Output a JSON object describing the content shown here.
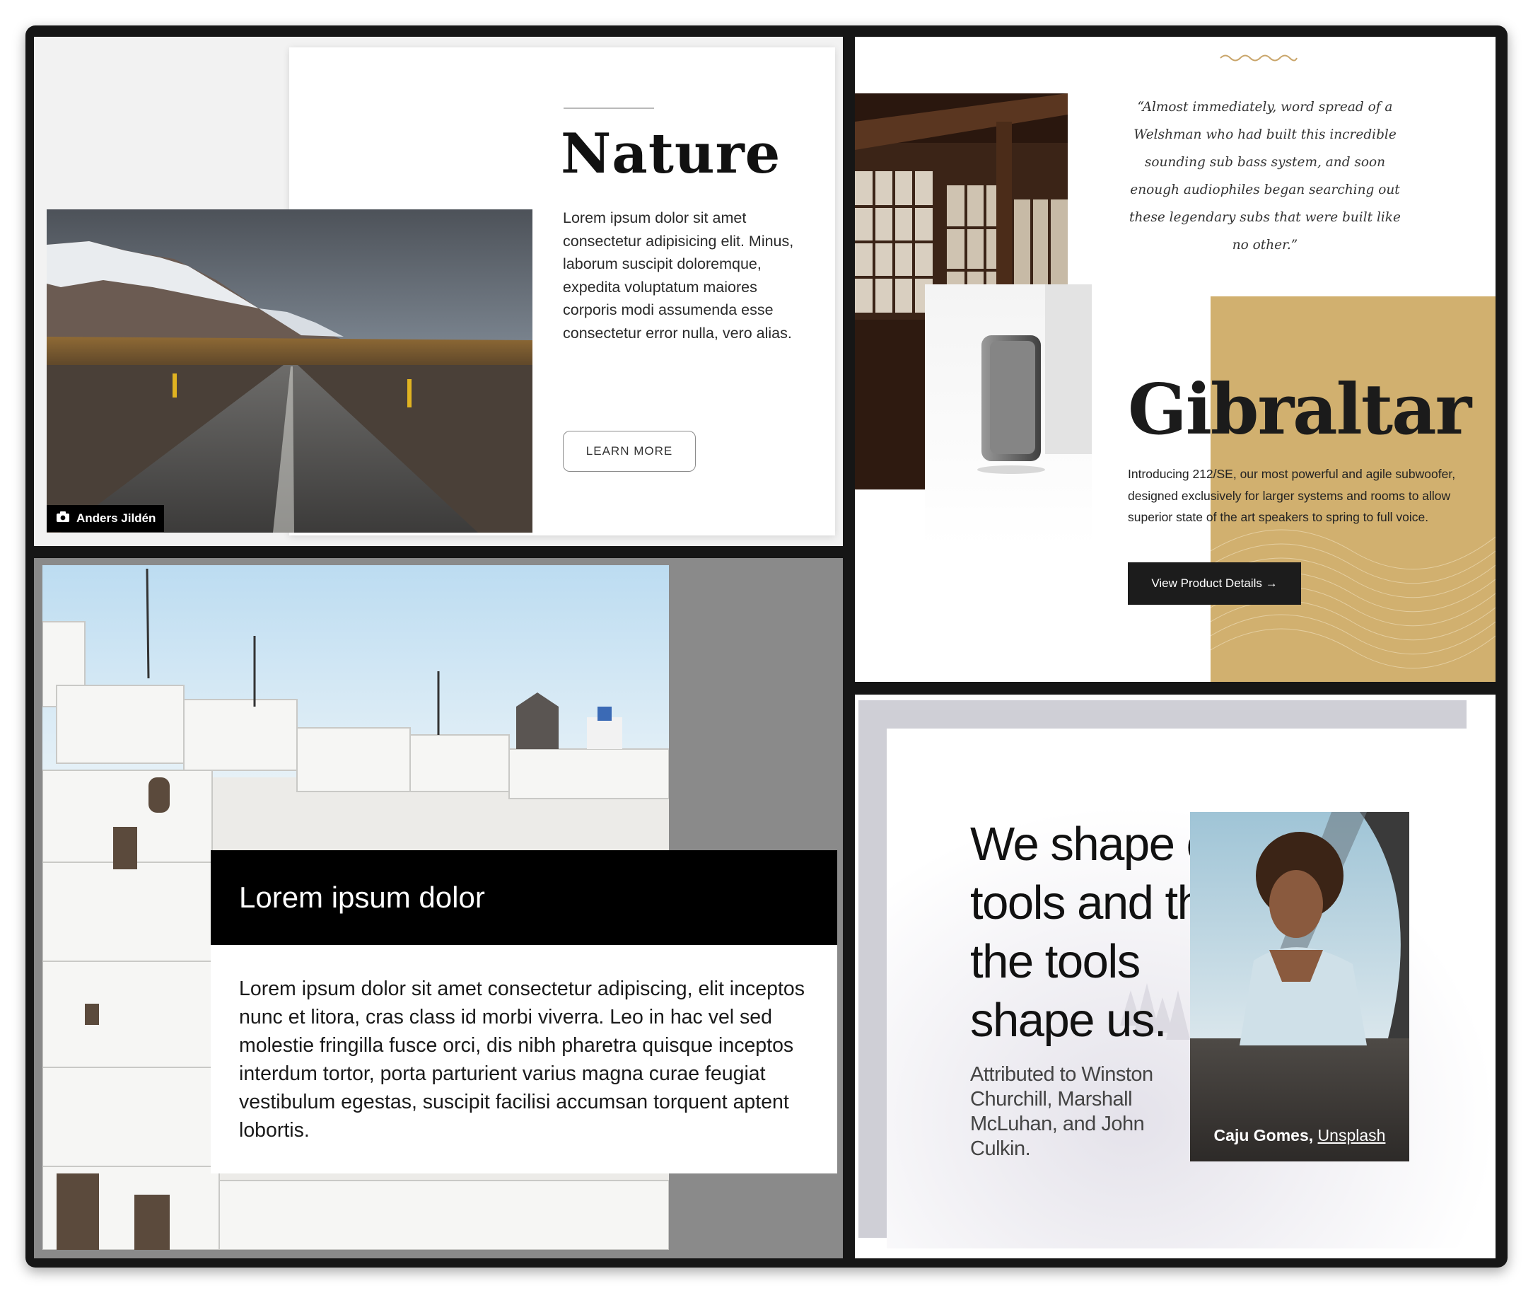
{
  "nature_card": {
    "title": "Nature",
    "body": "Lorem ipsum dolor sit amet consectetur adipisicing elit. Minus, laborum suscipit doloremque, expedita voluptatum maiores corporis modi assumenda esse consectetur error nulla, vero alias.",
    "button_label": "LEARN MORE",
    "photo_credit": "Anders Jildén",
    "credit_icon": "camera-icon"
  },
  "gibraltar_card": {
    "quote": "“Almost immediately, word spread of a Welshman who had built this incredible sounding sub bass system, and soon enough audiophiles began searching out these legendary subs that were built like no other.”",
    "title": "Gibraltar",
    "body": "Introducing 212/SE, our most powerful and agile subwoofer, designed exclusively for larger systems and rooms to allow superior state of the art speakers to spring to full voice.",
    "button_label": "View Product Details →",
    "accent_color": "#d1b06f"
  },
  "santorini_card": {
    "heading": "Lorem ipsum dolor",
    "body": "Lorem ipsum dolor sit amet consectetur adipiscing, elit inceptos nunc et litora, cras class id morbi viverra. Leo in hac vel sed molestie fringilla fusce orci, dis nibh pharetra quisque inceptos interdum tortor, porta parturient varius magna curae feugiat vestibulum egestas, suscipit facilisi accumsan torquent aptent lobortis."
  },
  "quote_card": {
    "quote": "We shape our tools and then the tools shape us.",
    "attribution": "Attributed to Winston Churchill, Marshall McLuhan, and John Culkin.",
    "photo_credit_name": "Caju Gomes",
    "photo_credit_separator": ", ",
    "photo_credit_link": "Unsplash"
  }
}
